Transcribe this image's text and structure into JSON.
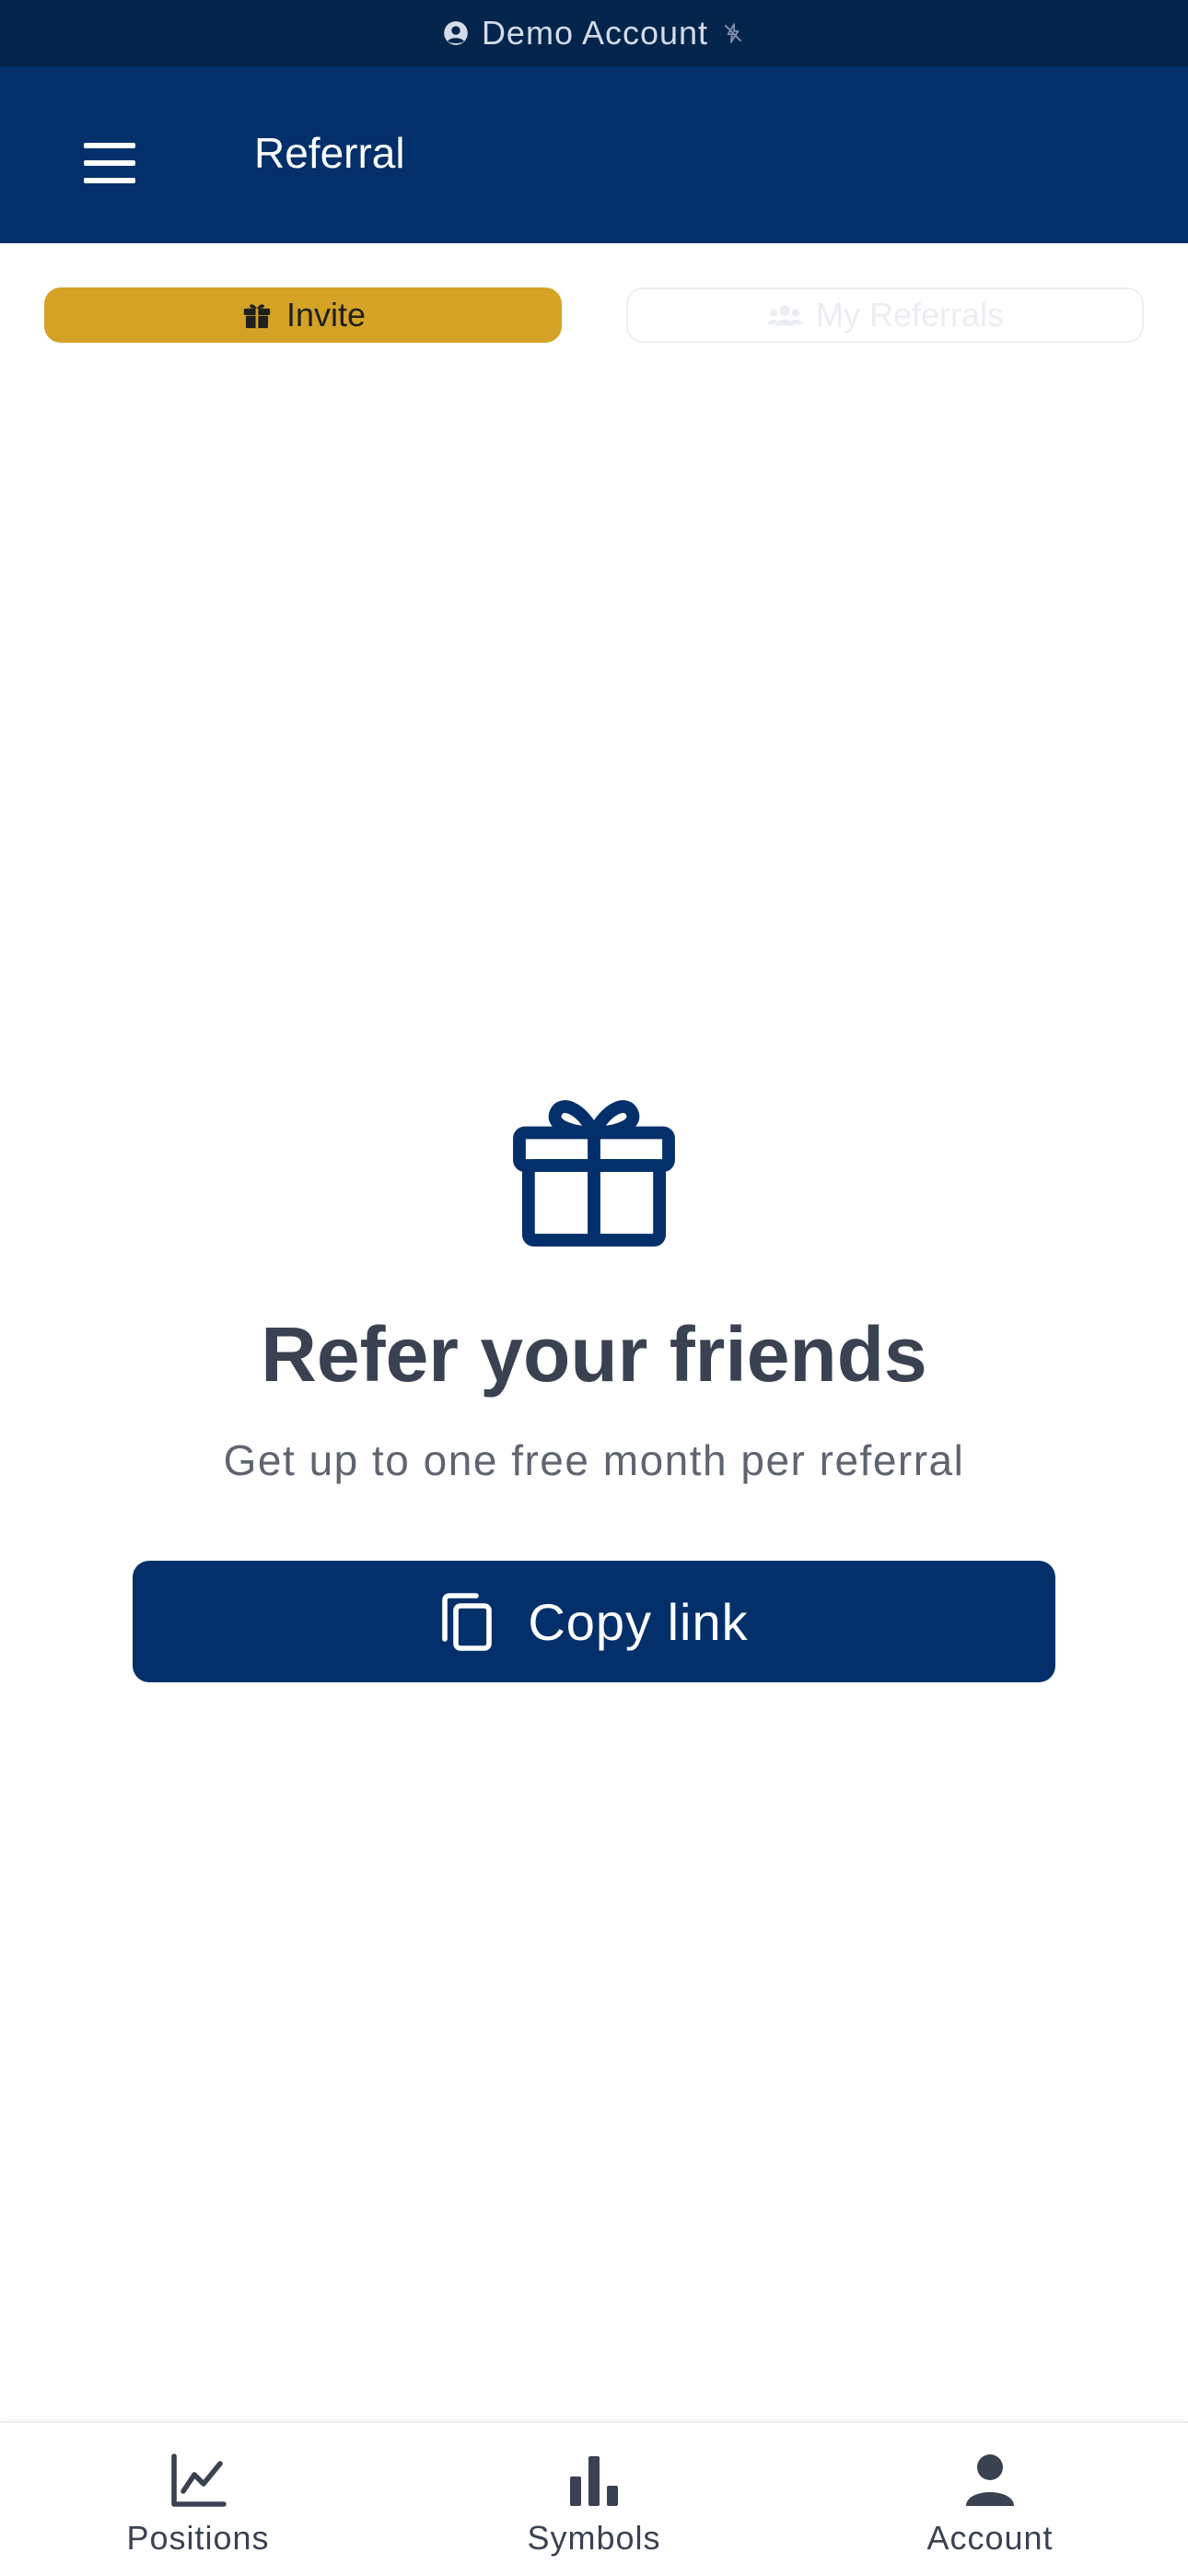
{
  "demo_bar": {
    "label": "Demo Account",
    "icons": [
      "user-circle-icon",
      "bolt-off-icon"
    ]
  },
  "app_bar": {
    "title": "Referral",
    "menu_icon": "hamburger-menu-icon",
    "background": "#03306a"
  },
  "tabs": [
    {
      "label": "Invite",
      "icon": "gift-icon",
      "active": true,
      "color": "#d4a326"
    },
    {
      "label": "My Referrals",
      "icon": "users-icon",
      "active": false
    }
  ],
  "hero": {
    "icon": "gift-icon",
    "title": "Refer your friends",
    "subtitle": "Get up to one free month per referral",
    "button_label": "Copy link",
    "button_icon": "copy-icon"
  },
  "bottom_nav": [
    {
      "label": "Positions",
      "icon": "line-chart-icon"
    },
    {
      "label": "Symbols",
      "icon": "bar-chart-icon"
    },
    {
      "label": "Account",
      "icon": "person-icon"
    }
  ],
  "colors": {
    "navy": "#03306a",
    "navy_dark": "#03244b",
    "gold": "#d4a326",
    "text_dark": "#3a4252"
  }
}
